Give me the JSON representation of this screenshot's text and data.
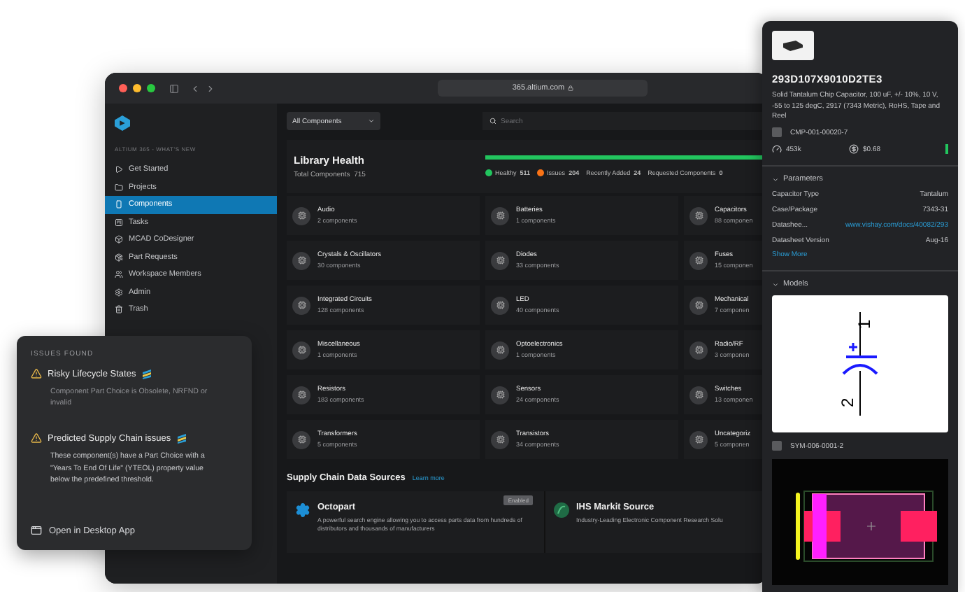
{
  "window": {
    "url": "365.altium.com"
  },
  "sidebar": {
    "workspace": "ALTIUM 365 - WHAT'S NEW",
    "items": [
      {
        "label": "Get Started",
        "selected": false
      },
      {
        "label": "Projects",
        "selected": false
      },
      {
        "label": "Components",
        "selected": true
      },
      {
        "label": "Tasks",
        "selected": false
      },
      {
        "label": "MCAD CoDesigner",
        "selected": false
      },
      {
        "label": "Part Requests",
        "selected": false
      },
      {
        "label": "Workspace Members",
        "selected": false
      },
      {
        "label": "Admin",
        "selected": false
      },
      {
        "label": "Trash",
        "selected": false
      }
    ]
  },
  "toolbar": {
    "filter": "All Components",
    "search": {
      "placeholder": "Search"
    }
  },
  "library_health": {
    "title": "Library Health",
    "total_label": "Total Components",
    "total_value": "715",
    "level": 1,
    "legend": [
      {
        "label": "Healthy",
        "value": "511",
        "color": "#22c55e"
      },
      {
        "label": "Issues",
        "value": "204",
        "color": "#f97316"
      },
      {
        "label": "Recently Added",
        "value": "24"
      },
      {
        "label": "Requested Components",
        "value": "0"
      }
    ]
  },
  "categories": [
    {
      "name": "Audio",
      "count": "2 components"
    },
    {
      "name": "Batteries",
      "count": "1 components"
    },
    {
      "name": "Capacitors",
      "count": "88 componen"
    },
    {
      "name": "Crystals & Oscillators",
      "count": "30 components"
    },
    {
      "name": "Diodes",
      "count": "33 components"
    },
    {
      "name": "Fuses",
      "count": "15 componen"
    },
    {
      "name": "Integrated Circuits",
      "count": "128 components"
    },
    {
      "name": "LED",
      "count": "40 components"
    },
    {
      "name": "Mechanical",
      "count": "7 componen"
    },
    {
      "name": "Miscellaneous",
      "count": "1 components"
    },
    {
      "name": "Optoelectronics",
      "count": "1 components"
    },
    {
      "name": "Radio/RF",
      "count": "3 componen"
    },
    {
      "name": "Resistors",
      "count": "183 components"
    },
    {
      "name": "Sensors",
      "count": "24 components"
    },
    {
      "name": "Switches",
      "count": "13 componen"
    },
    {
      "name": "Transformers",
      "count": "5 components"
    },
    {
      "name": "Transistors",
      "count": "34 components"
    },
    {
      "name": "Uncategoriz",
      "count": "5 componen"
    }
  ],
  "supply_chain": {
    "title": "Supply Chain Data Sources",
    "link": "Learn more",
    "sources": [
      {
        "name": "Octopart",
        "description": "A powerful search engine allowing you to access parts data from hundreds of distributors and thousands of manufacturers",
        "badge": "Enabled"
      },
      {
        "name": "IHS Markit Source",
        "description": "Industry-Leading Electronic Component Research Solu"
      }
    ]
  },
  "part_panel": {
    "title": "293D107X9010D2TE3",
    "description": "Solid Tantalum Chip Capacitor, 100 uF, +/- 10%, 10 V, -55 to 125 degC, 2917 (7343 Metric), RoHS, Tape and Reel",
    "component": {
      "id": "CMP-001-00020-7",
      "checked": false
    },
    "stock": "453k",
    "price": "$0.68",
    "parameters": {
      "title": "Parameters",
      "expanded": true,
      "more": "Show More",
      "rows": [
        {
          "label": "Capacitor Type",
          "value": "Tantalum",
          "kind": "text"
        },
        {
          "label": "Case/Package",
          "value": "7343-31",
          "kind": "text"
        },
        {
          "label": "Datashee...",
          "value": "www.vishay.com/docs/40082/293",
          "kind": "link"
        },
        {
          "label": "Datasheet Version",
          "value": "Aug-16",
          "kind": "text"
        }
      ]
    },
    "models": {
      "title": "Models",
      "expanded": true,
      "symbol": {
        "id": "SYM-006-0001-2",
        "checked": false,
        "pins": [
          "1",
          "2"
        ]
      }
    }
  },
  "issues_popup": {
    "title": "ISSUES FOUND",
    "items": [
      {
        "title": "Risky Lifecycle States",
        "description": "Component Part Choice is Obsolete, NRFND or invalid"
      },
      {
        "title": "Predicted Supply Chain issues",
        "description": "These component(s) have a Part Choice with a \"Years To End Of Life\" (YTEOL) property value below the predefined threshold."
      }
    ],
    "action": "Open in Desktop App"
  }
}
